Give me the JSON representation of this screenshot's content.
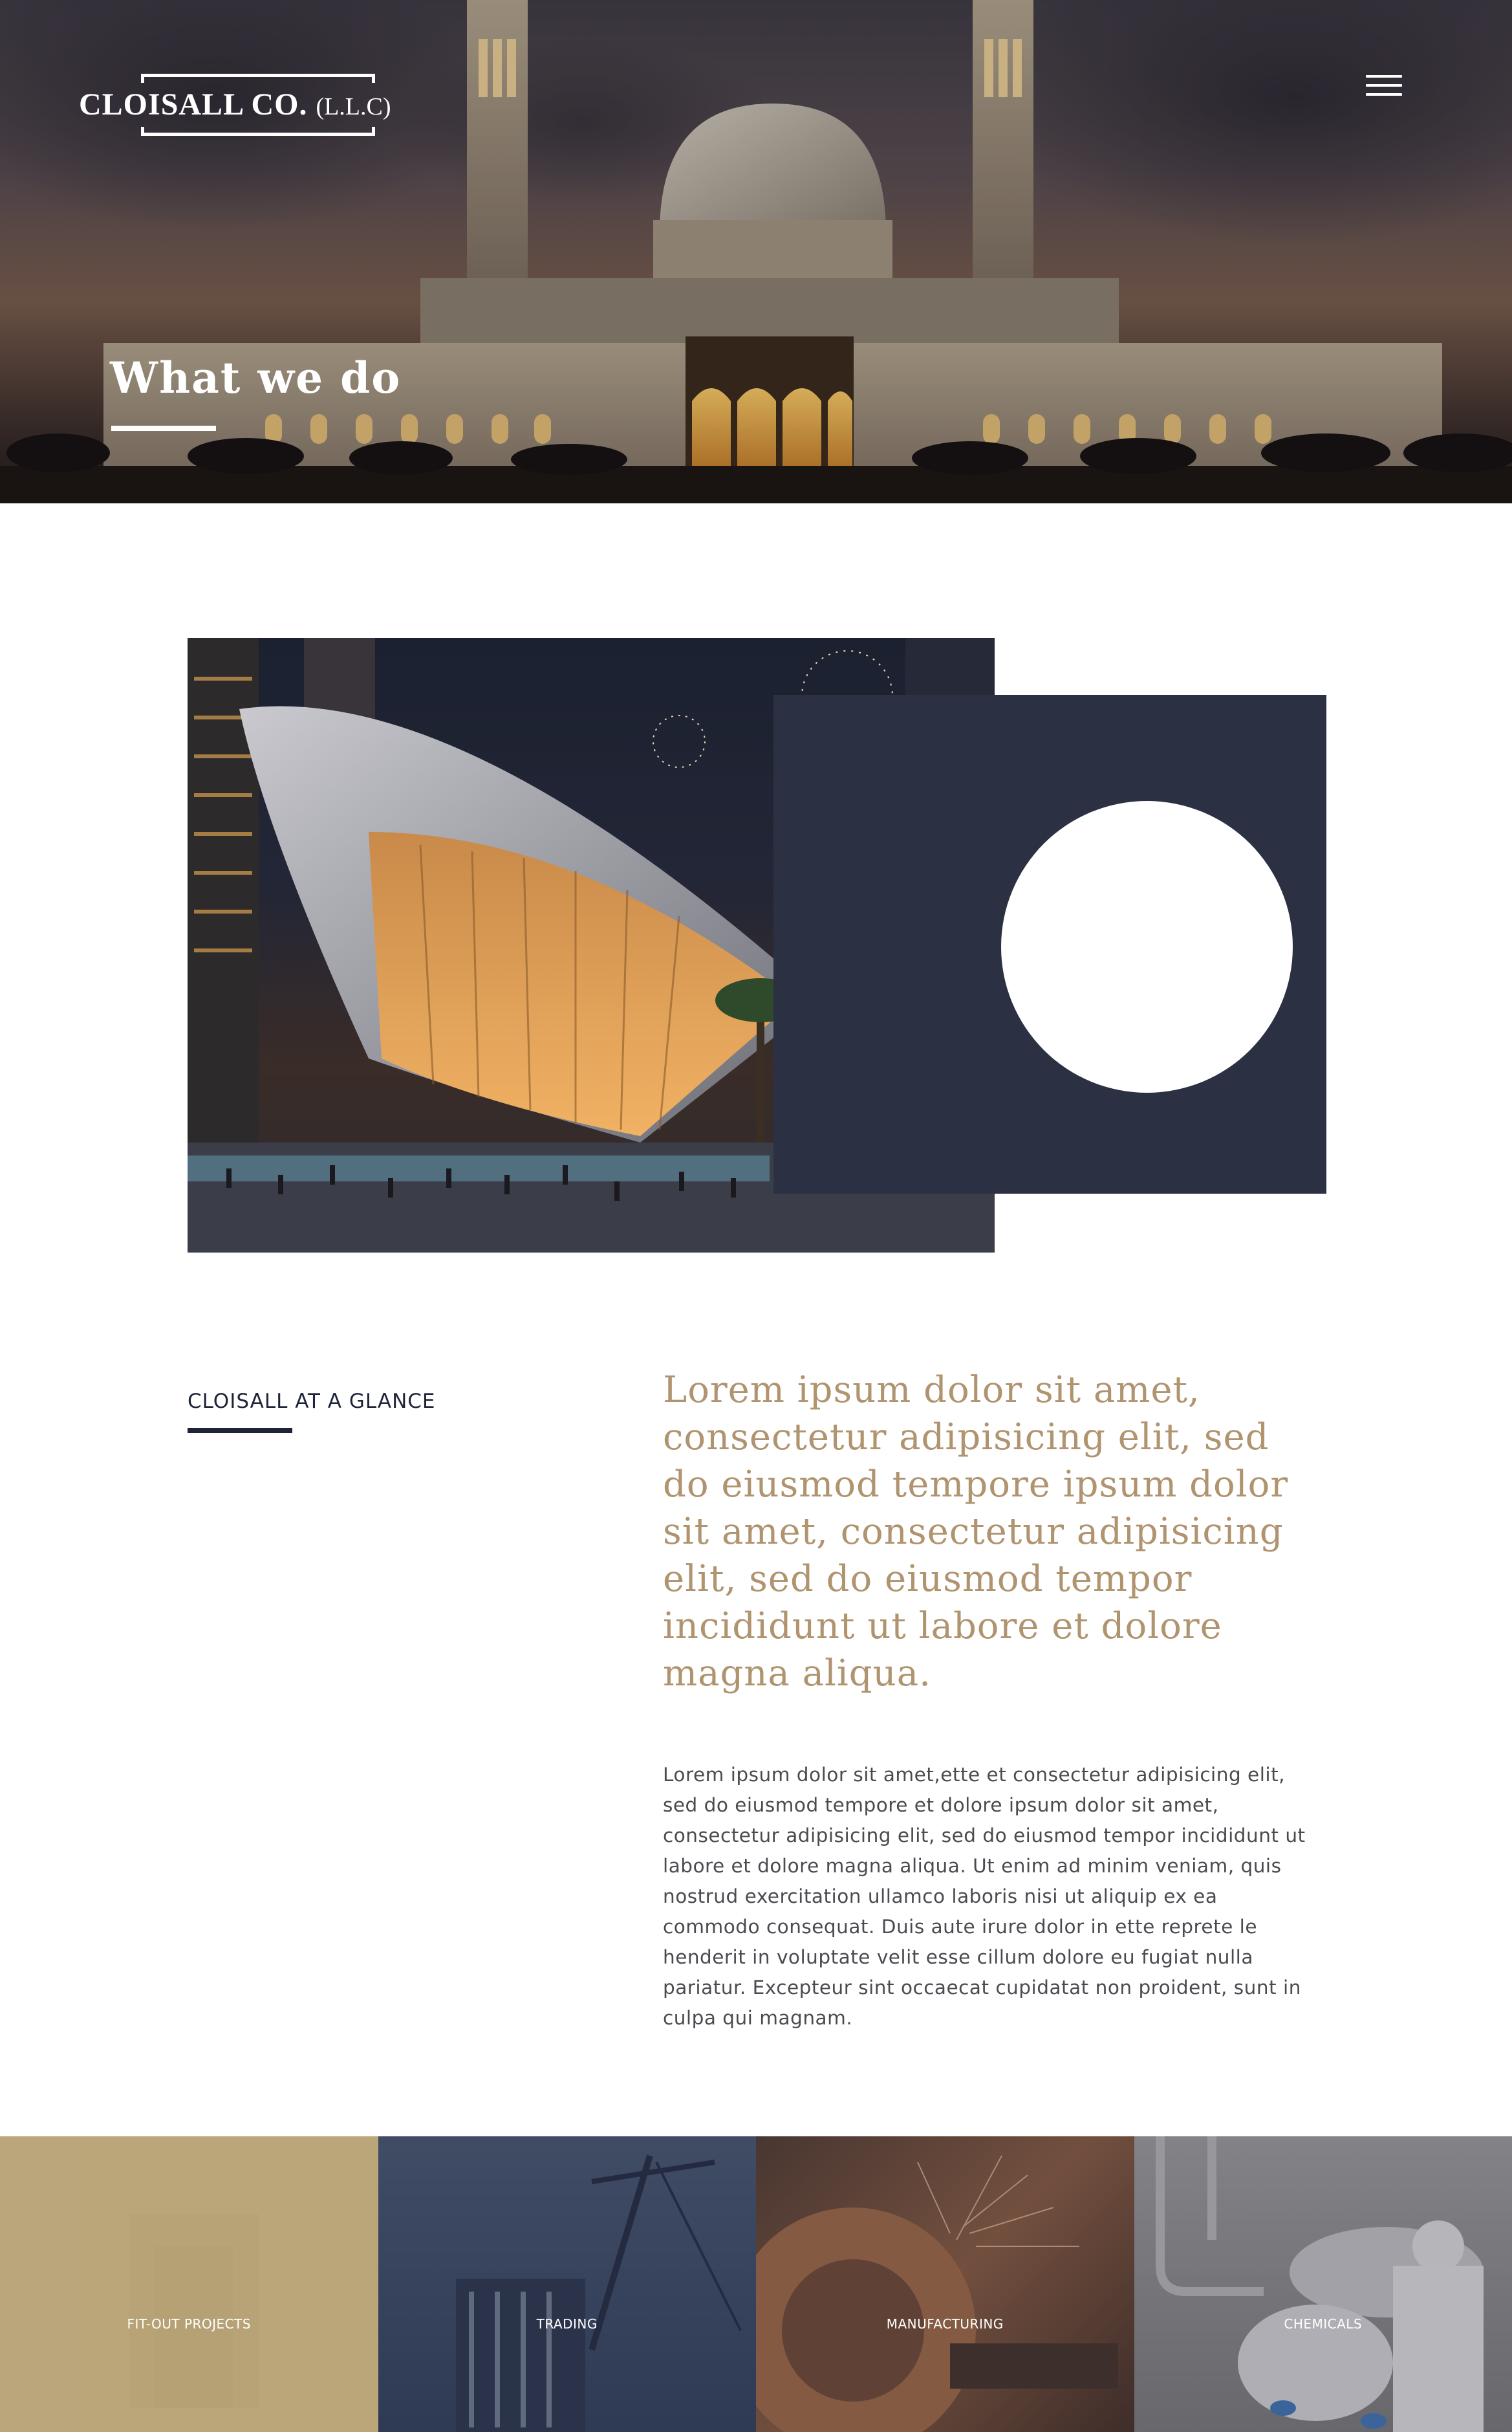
{
  "header": {
    "logo": {
      "name": "CLOISALL CO.",
      "suffix": "(L.L.C)"
    },
    "menu_icon": "hamburger-menu-icon"
  },
  "hero": {
    "title": "What we do"
  },
  "feature": {
    "image": "dubai-opera-house-photo",
    "play_icon": "play-circle"
  },
  "glance": {
    "label": "CLOISALL AT A GLANCE",
    "lead": "Lorem ipsum dolor sit amet, consectetur adipisicing elit, sed do eiusmod tempore ipsum dolor sit amet, consectetur adipisicing elit, sed do eiusmod tempor incididunt ut labore et dolore magna aliqua.",
    "body": "Lorem ipsum dolor sit amet,ette et consectetur adipisicing elit, sed do eiusmod tempore et dolore ipsum dolor sit amet, consectetur adipisicing elit, sed do eiusmod tempor incididunt ut labore et dolore magna aliqua. Ut enim ad minim veniam, quis nostrud exercitation ullamco laboris nisi ut aliquip ex ea commodo consequat. Duis aute irure dolor in ette reprete le henderit in voluptate velit esse cillum dolore eu fugiat nulla pariatur. Excepteur sint occaecat cupidatat non proident, sunt in culpa qui magnam."
  },
  "categories": [
    {
      "label": "FIT-OUT PROJECTS"
    },
    {
      "label": "TRADING"
    },
    {
      "label": "MANUFACTURING"
    },
    {
      "label": "CHEMICALS"
    }
  ],
  "colors": {
    "navy": "#2b3042",
    "gold_text": "#b09470",
    "heading_dark": "#1e2438",
    "body_text": "#4a4a50",
    "fitout_tile": "#b8a376"
  }
}
